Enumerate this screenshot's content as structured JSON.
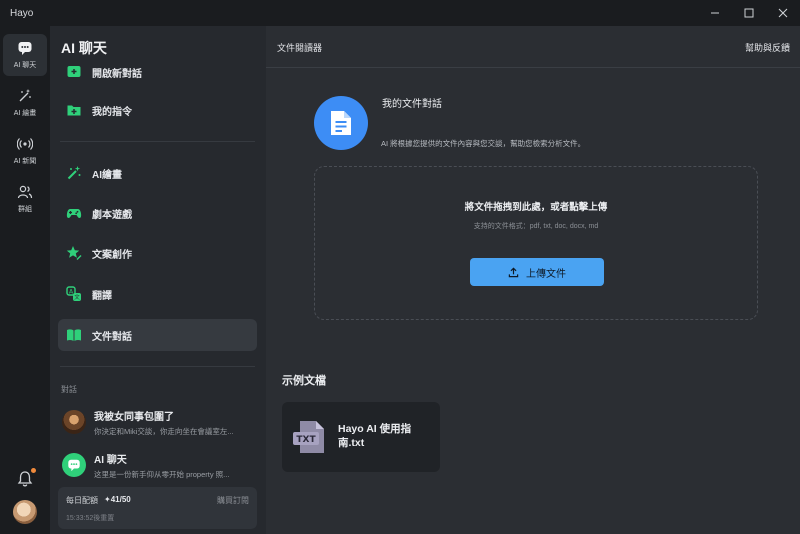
{
  "window": {
    "title": "Hayo",
    "controls": [
      "minimize",
      "maximize",
      "close"
    ]
  },
  "rail": {
    "items": [
      {
        "label": "AI 聊天",
        "icon": "chat-bubble-icon",
        "active": true
      },
      {
        "label": "AI 繪畫",
        "icon": "magic-wand-icon",
        "active": false
      },
      {
        "label": "AI 新聞",
        "icon": "broadcast-icon",
        "active": false
      },
      {
        "label": "群組",
        "icon": "group-icon",
        "active": false
      }
    ]
  },
  "sidebar": {
    "title": "AI 聊天",
    "menu": [
      {
        "label": "開啟新對話",
        "icon": "new-chat-icon"
      },
      {
        "label": "我的指令",
        "icon": "folder-plus-icon"
      },
      {
        "label": "AI繪畫",
        "icon": "magic-sparkle-icon"
      },
      {
        "label": "劇本遊戲",
        "icon": "gamepad-icon"
      },
      {
        "label": "文案創作",
        "icon": "star-pen-icon"
      },
      {
        "label": "翻譯",
        "icon": "translate-icon"
      },
      {
        "label": "文件對話",
        "icon": "book-icon",
        "active": true
      }
    ],
    "section_label": "對話",
    "conversations": [
      {
        "title": "我被女同事包圍了",
        "preview": "你決定和Miki交談，你走向坐在會議室左..."
      },
      {
        "title": "AI 聊天",
        "preview": "这里是一份新手仰从零开始 property 照..."
      }
    ],
    "quota": {
      "label": "每日配額",
      "count": "✦41/50",
      "buy": "購買訂閱",
      "reset": "15:33:52後重置"
    }
  },
  "main": {
    "header_title": "文件閱讀器",
    "help_link": "幫助與反饋",
    "doc_title": "我的文件對話",
    "doc_desc": "AI 將根據您提供的文件內容與您交談，幫助您檢索分析文件。",
    "dropzone": {
      "title": "將文件拖拽到此處，或者點擊上傳",
      "formats": "支持的文件格式：pdf, txt, doc, docx, md",
      "button": "上傳文件"
    },
    "examples_title": "示例文檔",
    "example": {
      "name": "Hayo AI 使用指南.txt",
      "badge": "TXT"
    }
  },
  "colors": {
    "accent": "#4aa3f2",
    "logo_bg": "#3d8df5",
    "green_icon": "#2fd07a",
    "notification": "#f08a3c"
  }
}
